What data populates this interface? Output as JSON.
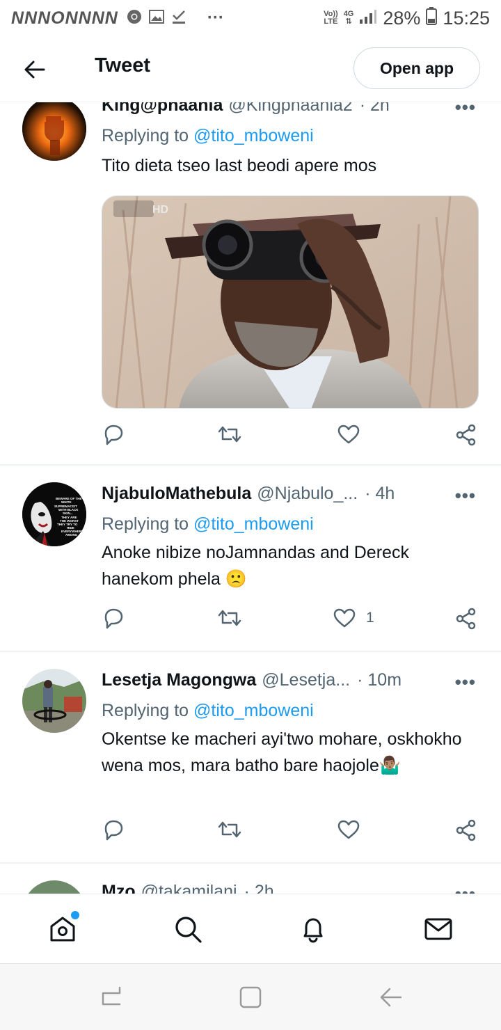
{
  "status_bar": {
    "left_marks": "NNNONNNN",
    "overflow": "···",
    "volte_line1": "Vo))",
    "volte_line2": "LTE",
    "network": "4G",
    "battery": "28%",
    "time": "15:25"
  },
  "header": {
    "title": "Tweet",
    "open_app_label": "Open app"
  },
  "tweets": [
    {
      "name": "King@phaahla",
      "handle": "@Kingphaahla2",
      "time": "· 2h",
      "replying_prefix": "Replying to",
      "replying_mention": "@tito_mboweni",
      "text": "Tito dieta tseo last beodi apere mos",
      "like_count": ""
    },
    {
      "name": "NjabuloMathebula",
      "handle": "@Njabulo_...",
      "time": "· 4h",
      "replying_prefix": "Replying to",
      "replying_mention": "@tito_mboweni",
      "text": "Anoke nibize noJamnandas and Dereck hanekom phela 🙁",
      "like_count": "1",
      "avatar_text": [
        "BEWARE OF THE",
        "WHITE",
        "SUPREMACIST",
        "WITH BLACK",
        "SKIN...",
        "THEY ARE",
        "THE WORST",
        "THEY TRY TO",
        "HIDE",
        "EVERYWHERE",
        "AMONG"
      ]
    },
    {
      "name": "Lesetja Magongwa",
      "handle": "@Lesetja...",
      "time": "· 10m",
      "replying_prefix": "Replying to",
      "replying_mention": "@tito_mboweni",
      "text": "Okentse ke macheri ayi'two mohare, oskhokho wena mos, mara batho bare haojole🤷🏽‍♂️",
      "like_count": ""
    },
    {
      "name": "Mzo",
      "handle": "@takamilani",
      "time": "· 2h"
    }
  ],
  "media_badge": "HD",
  "colors": {
    "accent": "#1d9bf0",
    "secondary_text": "#536471",
    "primary_text": "#0f1419"
  }
}
